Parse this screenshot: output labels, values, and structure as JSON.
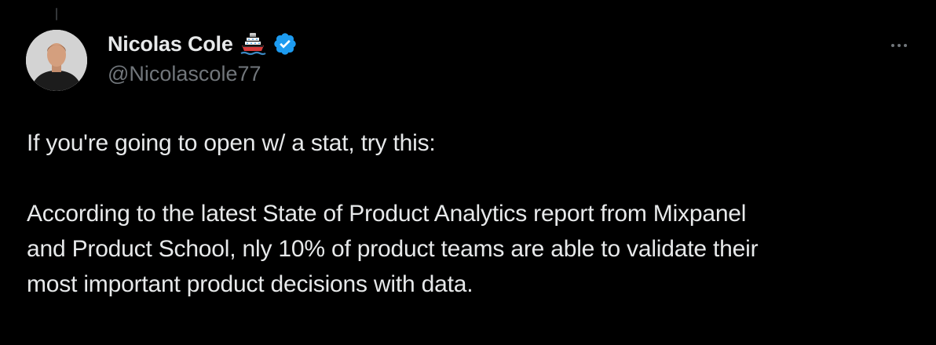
{
  "tweet": {
    "author": {
      "display_name": "Nicolas Cole",
      "handle": "@Nicolascole77",
      "name_emoji": "ship-icon",
      "verified_badge": "verified-icon",
      "verified_color": "#1d9bf0"
    },
    "menu_icon": "more-icon",
    "text": {
      "line1": "If you're going to open w/ a stat, try this:",
      "line2": "According to the latest State of Product Analytics report from Mixpanel",
      "line3": "and Product School, nly 10% of product teams are able to validate their",
      "line4": "most important product decisions with data."
    }
  },
  "colors": {
    "background": "#000000",
    "text_primary": "#e7e9ea",
    "text_secondary": "#71767b"
  }
}
